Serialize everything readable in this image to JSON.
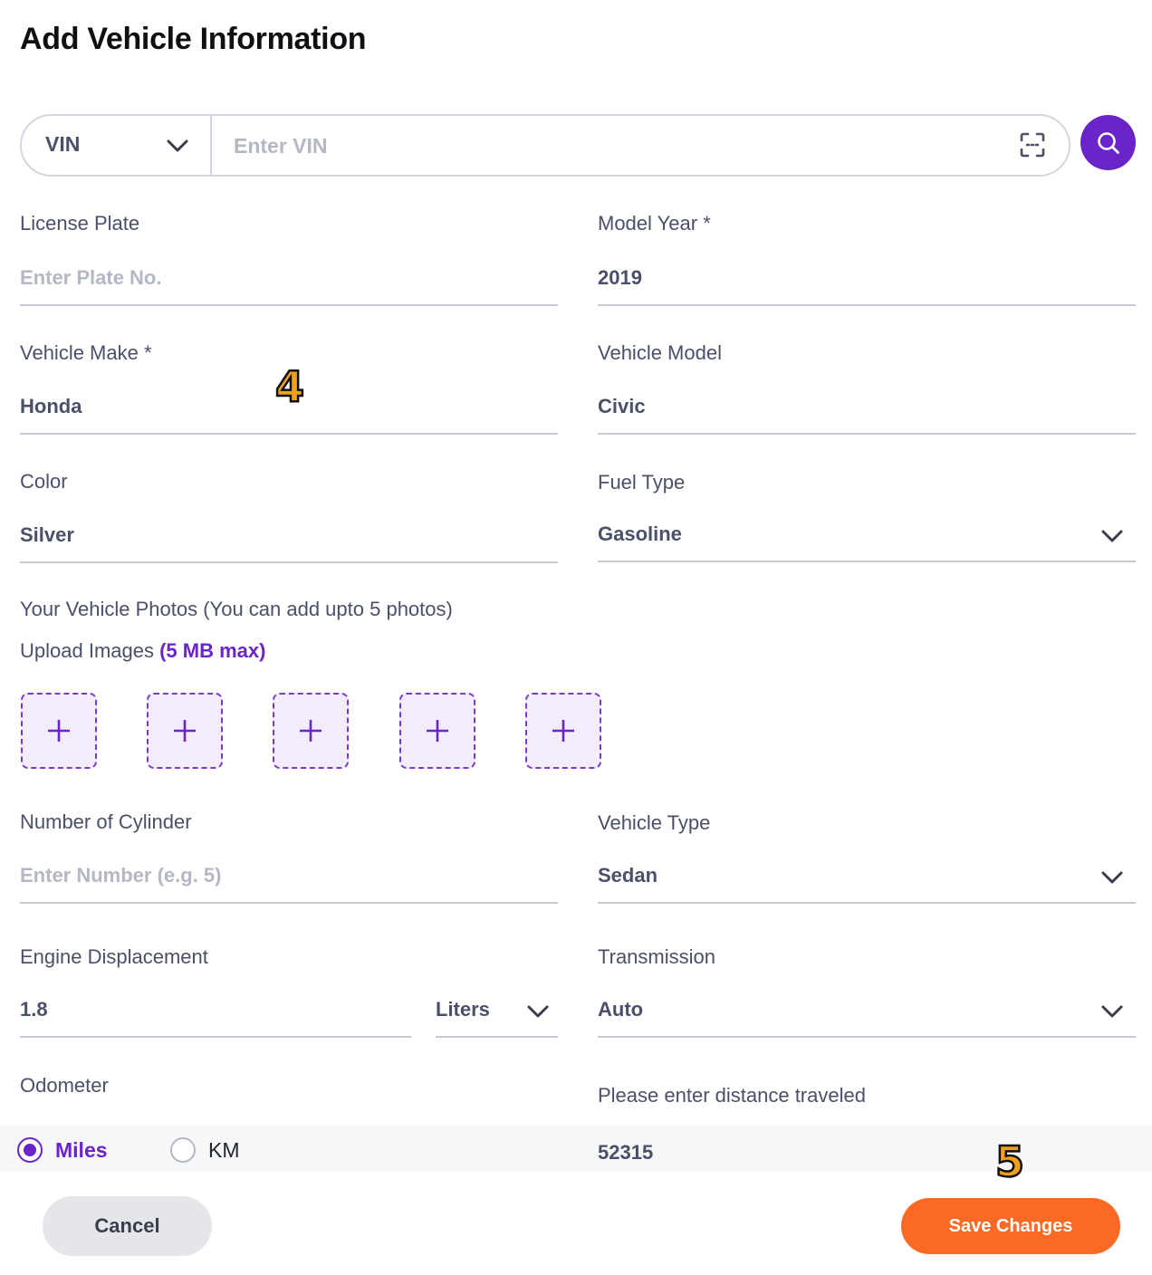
{
  "page": {
    "title": "Add Vehicle Information"
  },
  "vin": {
    "type_label": "VIN",
    "placeholder": "Enter VIN",
    "value": ""
  },
  "license_plate": {
    "label": "License Plate",
    "placeholder": "Enter Plate No.",
    "value": ""
  },
  "model_year": {
    "label": "Model Year *",
    "value": "2019"
  },
  "vehicle_make": {
    "label": "Vehicle Make *",
    "value": "Honda"
  },
  "vehicle_model": {
    "label": "Vehicle Model",
    "value": "Civic"
  },
  "color": {
    "label": "Color",
    "value": "Silver"
  },
  "fuel_type": {
    "label": "Fuel Type",
    "value": "Gasoline"
  },
  "photos": {
    "label": "Your Vehicle Photos (You can add upto 5 photos)",
    "upload_label": "Upload Images",
    "upload_max": "(5 MB max)",
    "slot_count": 5
  },
  "cylinders": {
    "label": "Number of Cylinder",
    "placeholder": "Enter Number (e.g. 5)",
    "value": ""
  },
  "vehicle_type": {
    "label": "Vehicle Type",
    "value": "Sedan"
  },
  "engine_displacement": {
    "label": "Engine Displacement",
    "value": "1.8",
    "unit": "Liters"
  },
  "transmission": {
    "label": "Transmission",
    "value": "Auto"
  },
  "odometer": {
    "label": "Odometer",
    "options": [
      "Miles",
      "KM"
    ],
    "selected": "Miles",
    "distance_label": "Please enter distance traveled",
    "distance_value": "52315"
  },
  "actions": {
    "cancel_label": "Cancel",
    "save_label": "Save Changes"
  },
  "markers": {
    "step_4": "4",
    "step_5": "5"
  },
  "colors": {
    "accent": "#6a24c8",
    "save": "#fb6a24",
    "cancel_bg": "#e4e6ea",
    "text": "#4a5068",
    "placeholder": "#b4b7c4",
    "line": "#c7c9d2"
  }
}
